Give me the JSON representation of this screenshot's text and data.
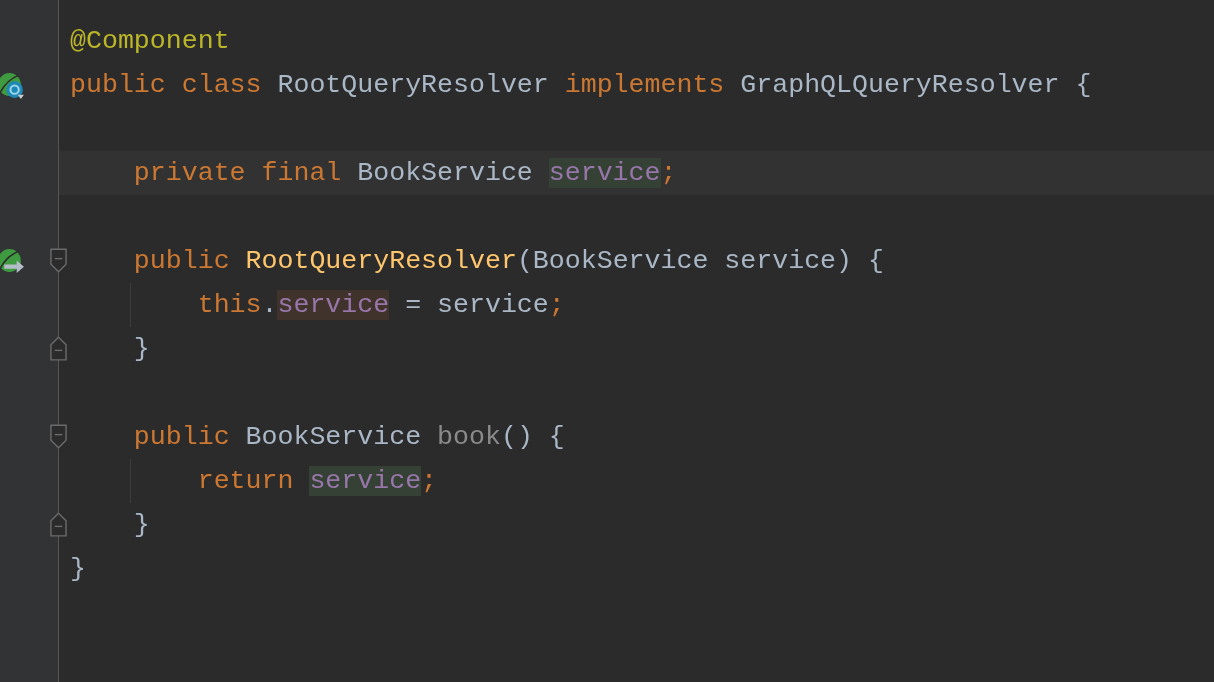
{
  "editor": {
    "lines": [
      {
        "kind": "code",
        "tokens": [
          {
            "text": "@Component",
            "kind": "annotation"
          }
        ]
      },
      {
        "kind": "code",
        "gutter_icon": {
          "kind": "bean"
        },
        "tokens": [
          {
            "text": "public class ",
            "kind": "keyword"
          },
          {
            "text": "RootQueryResolver ",
            "kind": "plain"
          },
          {
            "text": "implements ",
            "kind": "keyword"
          },
          {
            "text": "GraphQLQueryResolver {",
            "kind": "plain"
          }
        ]
      },
      {
        "kind": "blank"
      },
      {
        "kind": "code",
        "current": true,
        "tokens": [
          {
            "text": "    private final ",
            "kind": "keyword"
          },
          {
            "text": "BookService ",
            "kind": "plain"
          },
          {
            "text": "service",
            "kind": "field",
            "read_highlight": true
          },
          {
            "text": ";",
            "kind": "keyword"
          }
        ]
      },
      {
        "kind": "blank"
      },
      {
        "kind": "code",
        "gutter_icon": {
          "kind": "autowired"
        },
        "fold_start": true,
        "tokens": [
          {
            "text": "    public ",
            "kind": "keyword"
          },
          {
            "text": "RootQueryResolver",
            "kind": "method"
          },
          {
            "text": "(BookService service) {",
            "kind": "plain"
          }
        ]
      },
      {
        "kind": "code",
        "guide": true,
        "tokens": [
          {
            "text": "        this",
            "kind": "keyword"
          },
          {
            "text": ".",
            "kind": "plain"
          },
          {
            "text": "service",
            "kind": "field",
            "write_highlight": true
          },
          {
            "text": " = service",
            "kind": "plain"
          },
          {
            "text": ";",
            "kind": "keyword"
          }
        ]
      },
      {
        "kind": "code",
        "fold_end": true,
        "tokens": [
          {
            "text": "    }",
            "kind": "plain"
          }
        ]
      },
      {
        "kind": "blank"
      },
      {
        "kind": "code",
        "fold_start": true,
        "tokens": [
          {
            "text": "    public ",
            "kind": "keyword"
          },
          {
            "text": "BookService ",
            "kind": "plain"
          },
          {
            "text": "book",
            "kind": "unused"
          },
          {
            "text": "() {",
            "kind": "plain"
          }
        ]
      },
      {
        "kind": "code",
        "guide": true,
        "tokens": [
          {
            "text": "        return ",
            "kind": "keyword"
          },
          {
            "text": "service",
            "kind": "field",
            "read_highlight": true
          },
          {
            "text": ";",
            "kind": "keyword"
          }
        ]
      },
      {
        "kind": "code",
        "fold_end": true,
        "tokens": [
          {
            "text": "    }",
            "kind": "plain"
          }
        ]
      },
      {
        "kind": "code",
        "tokens": [
          {
            "text": "}",
            "kind": "plain"
          }
        ]
      }
    ]
  }
}
